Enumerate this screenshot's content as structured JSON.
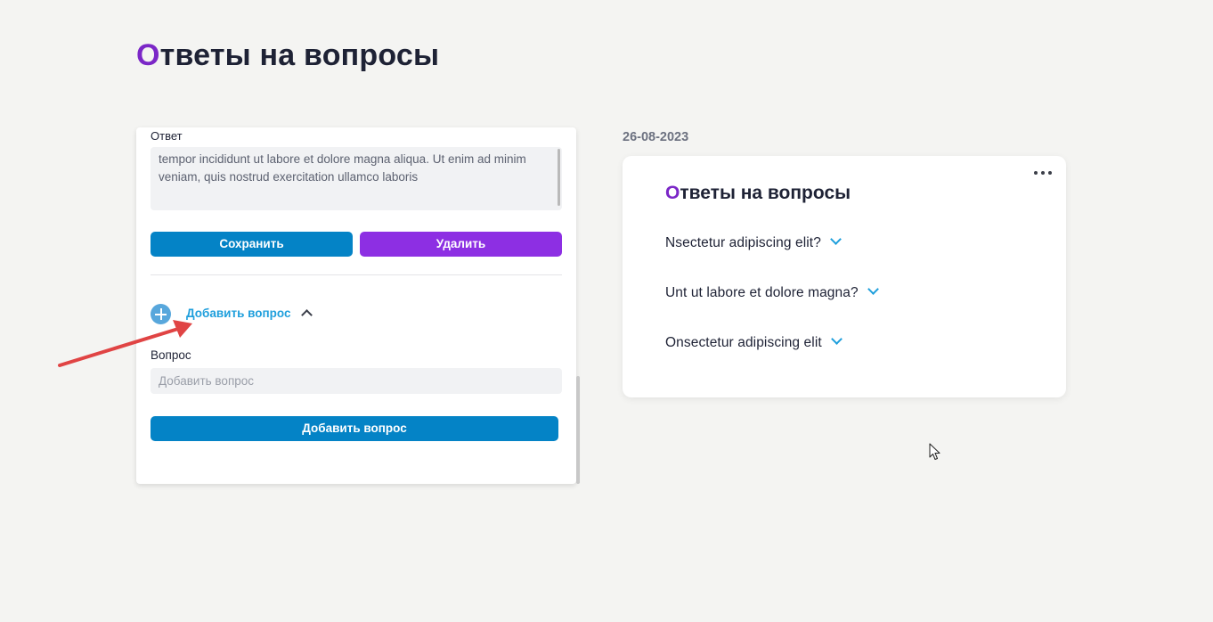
{
  "page": {
    "title_first": "О",
    "title_rest": "тветы на вопросы"
  },
  "editor": {
    "answer_label": "Ответ",
    "answer_text": "tempor incididunt ut labore et dolore magna aliqua. Ut enim ad minim veniam, quis nostrud exercitation ullamco laboris",
    "save_label": "Сохранить",
    "delete_label": "Удалить",
    "add_toggle_label": "Добавить вопрос",
    "question_label": "Вопрос",
    "question_placeholder": "Добавить вопрос",
    "question_value": "",
    "add_button_label": "Добавить вопрос"
  },
  "preview": {
    "date": "26-08-2023",
    "title_first": "О",
    "title_rest": "тветы на вопросы",
    "faq": [
      {
        "question": "Nsectetur adipiscing elit?"
      },
      {
        "question": "Unt ut labore et dolore magna?"
      },
      {
        "question": "Onsectetur adipiscing elit"
      }
    ]
  },
  "colors": {
    "accent_purple": "#7b27c7",
    "primary_blue": "#0483c6",
    "delete_purple": "#8d2fe3",
    "link_blue": "#1f9fdc",
    "annotation_red": "#e04444",
    "background": "#f4f4f2"
  },
  "icons": {
    "add": "plus-circle-icon",
    "collapse": "chevron-up-icon",
    "expand": "chevron-down-icon",
    "more": "more-horizontal-icon",
    "annotation": "red-arrow-icon"
  }
}
